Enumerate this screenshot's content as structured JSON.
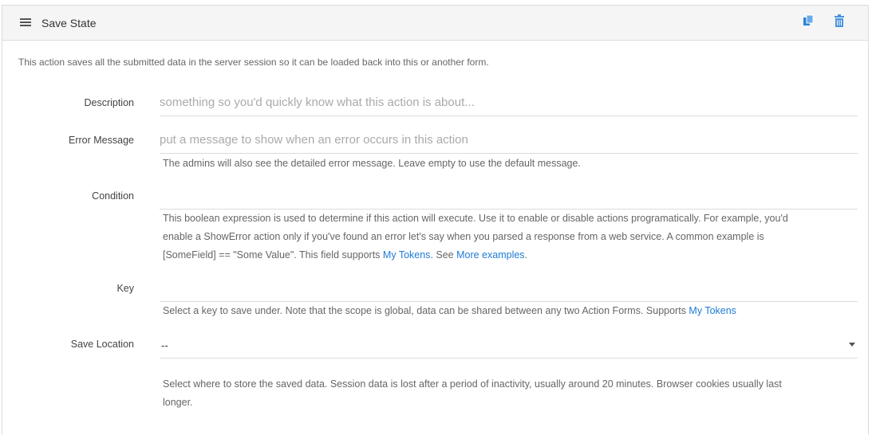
{
  "panel": {
    "title": "Save State",
    "intro": "This action saves all the submitted data in the server session so it can be loaded back into this or another form."
  },
  "fields": {
    "description": {
      "label": "Description",
      "value": "",
      "placeholder": "something so you'd quickly know what this action is about..."
    },
    "error_message": {
      "label": "Error Message",
      "value": "",
      "placeholder": "put a message to show when an error occurs in this action",
      "help": "The admins will also see the detailed error message. Leave empty to use the default message."
    },
    "condition": {
      "label": "Condition",
      "value": "",
      "help_line1": "This boolean expression is used to determine if this action will execute. Use it to enable or disable actions programatically. For example, you'd",
      "help_line2": "enable a ShowError action only if you've found an error let's say when you parsed a response from a web service. A common example is",
      "help_line3_pre": "[SomeField] == \"Some Value\". This field supports ",
      "help_link1": "My Tokens",
      "help_mid": ". See ",
      "help_link2": "More examples",
      "help_end": "."
    },
    "key": {
      "label": "Key",
      "value": "",
      "help_pre": "Select a key to save under. Note that the scope is global, data can be shared between any two Action Forms. Supports ",
      "help_link": "My Tokens"
    },
    "save_location": {
      "label": "Save Location",
      "selected": "--",
      "help_line1": "Select where to store the saved data. Session data is lost after a period of inactivity, usually around 20 minutes. Browser cookies usually last",
      "help_line2": "longer."
    }
  },
  "icons": {
    "drag": "drag-handle-icon",
    "copy": "copy-icon",
    "delete": "trash-icon"
  },
  "colors": {
    "accent": "#1e7bd6",
    "header_bg": "#f5f5f5"
  }
}
